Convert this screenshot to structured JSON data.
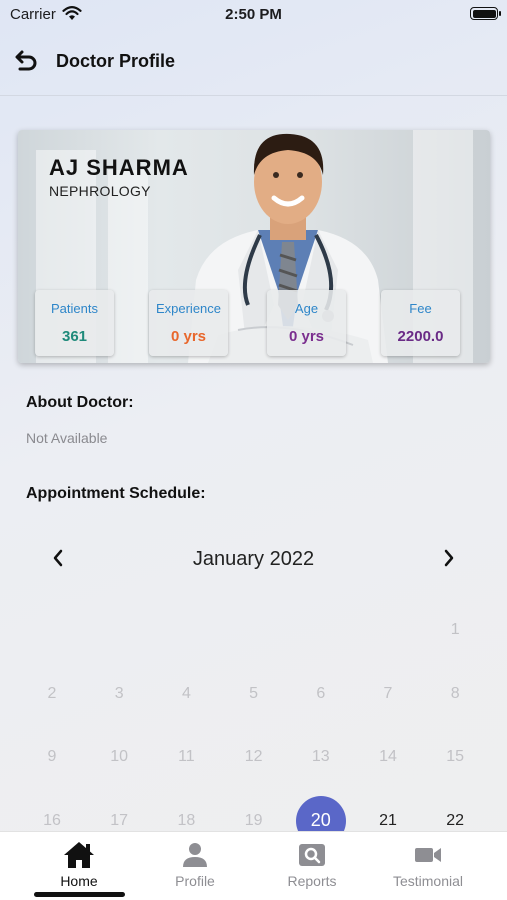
{
  "status_bar": {
    "carrier": "Carrier",
    "time": "2:50 PM"
  },
  "header": {
    "title": "Doctor Profile",
    "back_icon": "back-arrow-icon"
  },
  "doctor": {
    "name": "AJ  SHARMA",
    "specialty": "NEPHROLOGY",
    "stats": [
      {
        "label": "Patients",
        "value": "361",
        "color": "#1f8a7a"
      },
      {
        "label": "Experience",
        "value": "0 yrs",
        "color": "#e8672c"
      },
      {
        "label": "Age",
        "value": "0 yrs",
        "color": "#7a2e8e"
      },
      {
        "label": "Fee",
        "value": "2200.0",
        "color": "#6a2b86"
      }
    ]
  },
  "about": {
    "title": "About Doctor:",
    "text": "Not Available"
  },
  "schedule": {
    "title": "Appointment Schedule:",
    "month": "January 2022",
    "prev_icon": "chevron-left-icon",
    "next_icon": "chevron-right-icon",
    "days": [
      [
        "",
        "",
        "",
        "",
        "",
        "",
        "1"
      ],
      [
        "2",
        "3",
        "4",
        "5",
        "6",
        "7",
        "8"
      ],
      [
        "9",
        "10",
        "11",
        "12",
        "13",
        "14",
        "15"
      ],
      [
        "16",
        "17",
        "18",
        "19",
        "20",
        "21",
        "22"
      ]
    ],
    "selected_day": "20",
    "active_days": [
      "21",
      "22"
    ],
    "selected_color": "#5a67c8"
  },
  "tabs": [
    {
      "label": "Home",
      "icon": "home-icon",
      "active": true
    },
    {
      "label": "Profile",
      "icon": "person-icon",
      "active": false
    },
    {
      "label": "Reports",
      "icon": "reports-search-icon",
      "active": false
    },
    {
      "label": "Testimonial",
      "icon": "video-camera-icon",
      "active": false
    }
  ]
}
